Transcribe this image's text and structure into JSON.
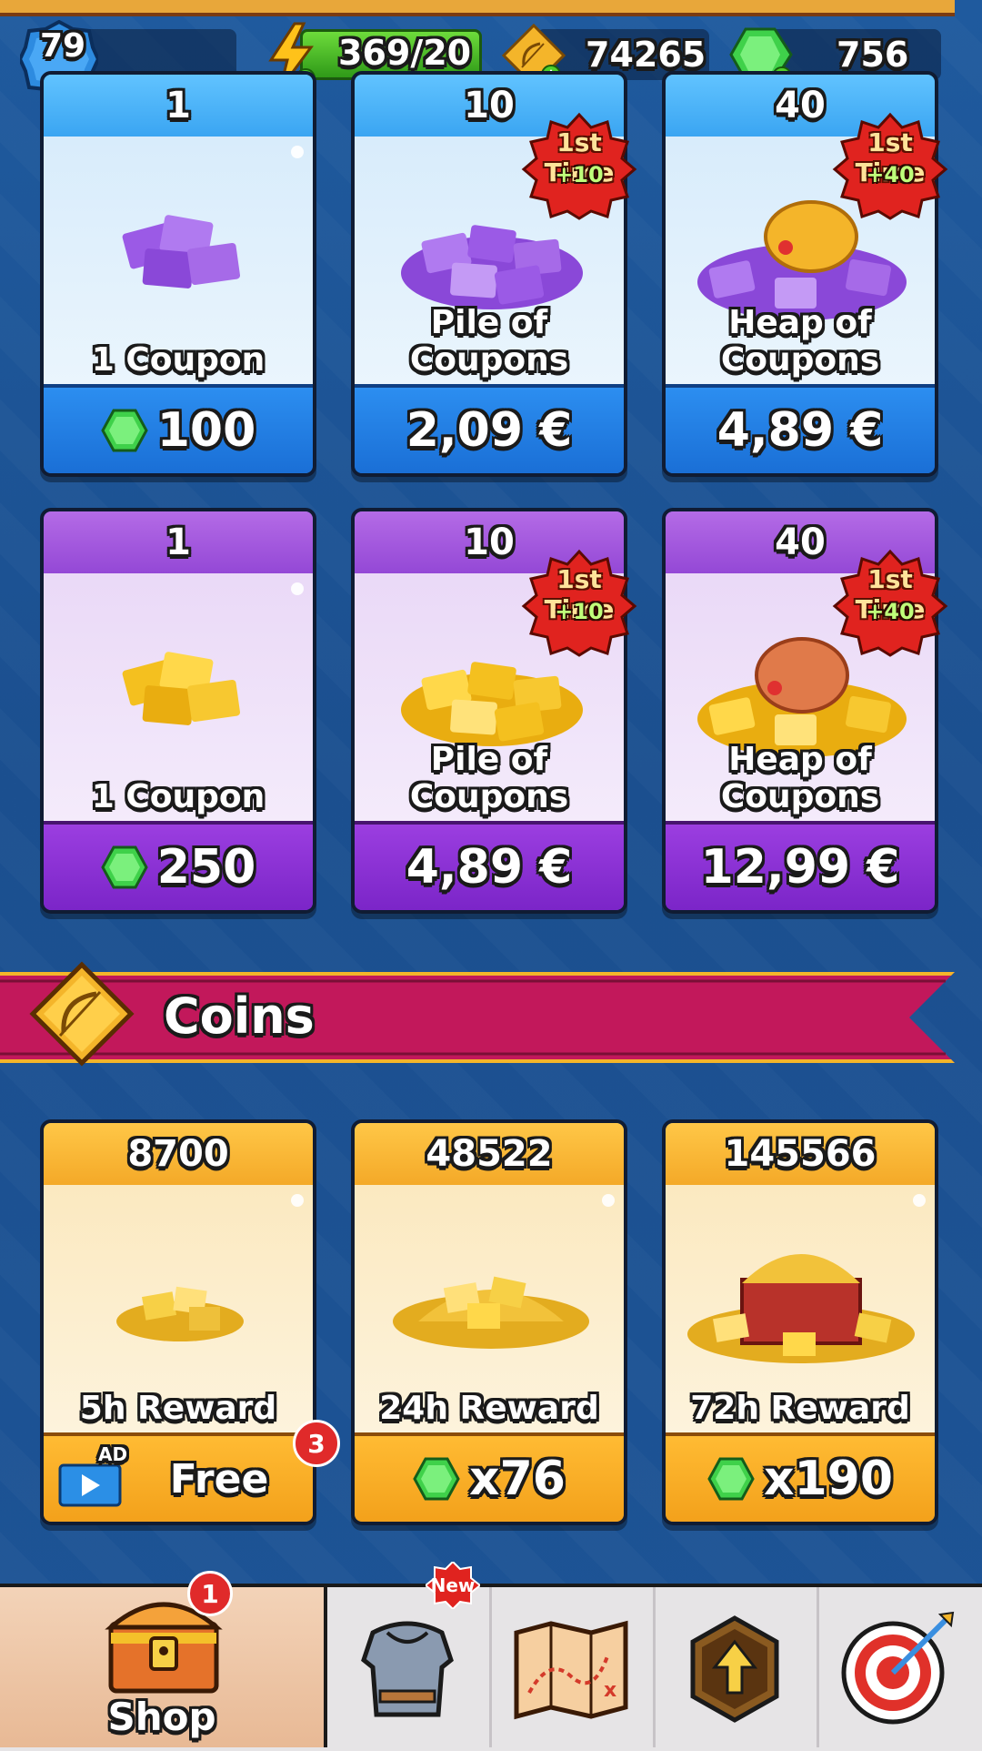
{
  "hud": {
    "level": "79",
    "energy": "369/20",
    "coins": "74265",
    "gems": "756"
  },
  "coupon_offers": [
    {
      "count": "1",
      "name": "1 Coupon",
      "price": "100",
      "price_type": "gems",
      "theme": "blue",
      "first_time": null
    },
    {
      "count": "10",
      "name": "Pile of Coupons",
      "price": "2,09 €",
      "price_type": "money",
      "theme": "blue",
      "first_time": {
        "label": "1st Time",
        "bonus": "+10"
      }
    },
    {
      "count": "40",
      "name": "Heap of Coupons",
      "price": "4,89 €",
      "price_type": "money",
      "theme": "blue",
      "first_time": {
        "label": "1st Time",
        "bonus": "+40"
      }
    },
    {
      "count": "1",
      "name": "1 Coupon",
      "price": "250",
      "price_type": "gems",
      "theme": "purple",
      "first_time": null
    },
    {
      "count": "10",
      "name": "Pile of Coupons",
      "price": "4,89 €",
      "price_type": "money",
      "theme": "purple",
      "first_time": {
        "label": "1st Time",
        "bonus": "+10"
      }
    },
    {
      "count": "40",
      "name": "Heap of Coupons",
      "price": "12,99 €",
      "price_type": "money",
      "theme": "purple",
      "first_time": {
        "label": "1st Time",
        "bonus": "+40"
      }
    }
  ],
  "coins_section": {
    "title": "Coins",
    "offers": [
      {
        "amount": "8700",
        "name": "5h Reward",
        "price": "Free",
        "ad_label": "AD",
        "notif": "3"
      },
      {
        "amount": "48522",
        "name": "24h Reward",
        "price": "x76"
      },
      {
        "amount": "145566",
        "name": "72h Reward",
        "price": "x190"
      }
    ]
  },
  "nav": {
    "shop_label": "Shop",
    "shop_badge": "1",
    "equipment_badge": "New"
  },
  "colors": {
    "gem_green": "#3fd14a",
    "banner_magenta": "#c2185b",
    "gold": "#f4b52a"
  }
}
